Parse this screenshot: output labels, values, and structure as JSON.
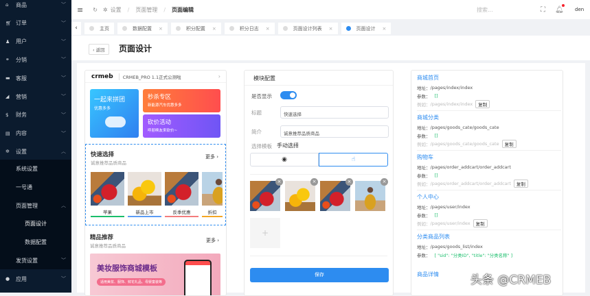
{
  "sidebar": {
    "items": [
      {
        "label": "商品",
        "icon": "basket-icon"
      },
      {
        "label": "订单",
        "icon": "cart-icon"
      },
      {
        "label": "用户",
        "icon": "user-icon"
      },
      {
        "label": "分销",
        "icon": "distribution-icon"
      },
      {
        "label": "客服",
        "icon": "chat-icon"
      },
      {
        "label": "营销",
        "icon": "megaphone-icon"
      },
      {
        "label": "财务",
        "icon": "dollar-icon"
      },
      {
        "label": "内容",
        "icon": "book-icon"
      },
      {
        "label": "设置",
        "icon": "gear-icon"
      }
    ],
    "sub": [
      "系统设置",
      "一号通",
      "页面管理",
      "发货设置"
    ],
    "sub2": [
      "页面设计",
      "数据配置"
    ],
    "last": "应用"
  },
  "header": {
    "breadcrumb": [
      "设置",
      "页面管理",
      "页面编辑"
    ],
    "search_placeholder": "搜索...",
    "user": "den"
  },
  "tabs": [
    {
      "label": "主页",
      "closable": false
    },
    {
      "label": "数据配置"
    },
    {
      "label": "积分配置"
    },
    {
      "label": "积分日志"
    },
    {
      "label": "页面设计列表"
    },
    {
      "label": "页面设计",
      "active": true
    }
  ],
  "page": {
    "back": "返回",
    "title": "页面设计"
  },
  "preview": {
    "logo": "crmeb",
    "app_title": "CRMEB_PRO 1.1正式公测啦",
    "banners": [
      {
        "title": "一起来拼团",
        "sub": "优惠多多"
      },
      {
        "title": "秒杀专区",
        "sub": "新能源汽车优惠多多"
      },
      {
        "title": "砍价活动",
        "sub": "呼朋唤友来砍价~"
      }
    ],
    "quick": {
      "title": "快速选择",
      "sub": "诚意推荐品质商品",
      "more": "更多",
      "items": [
        "苹果",
        "新品上市",
        "反季优惠",
        "折扣"
      ]
    },
    "featured": {
      "title": "精品推荐",
      "sub": "诚意推荐品质商品",
      "more": "更多",
      "banner_title": "美妆服饰商城模板",
      "banner_sub": "适用美妆、服饰、鲜花礼品、母婴童装等"
    }
  },
  "config": {
    "header": "模块配置",
    "show_label": "是否显示",
    "show": true,
    "title_label": "标题",
    "title_value": "快速选择",
    "intro_label": "简介",
    "intro_value": "诚意推荐品质商品",
    "template_label": "选择模板",
    "template_value": "手动选择",
    "save": "保存"
  },
  "links": [
    {
      "name": "商城首页",
      "addr_label": "地址：",
      "addr": "/pages/index/index",
      "param_label": "参数：",
      "param": "[]",
      "ex_label": "例如：",
      "ex": "/pages/index/index",
      "copy": "复制"
    },
    {
      "name": "商城分类",
      "addr_label": "地址：",
      "addr": "/pages/goods_cate/goods_cate",
      "param_label": "参数：",
      "param": "[]",
      "ex_label": "例如：",
      "ex": "/pages/goods_cate/goods_cate",
      "copy": "复制"
    },
    {
      "name": "购物车",
      "addr_label": "地址：",
      "addr": "/pages/order_addcart/order_addcart",
      "param_label": "参数：",
      "param": "[]",
      "ex_label": "例如：",
      "ex": "/pages/order_addcart/order_addcart",
      "copy": "复制"
    },
    {
      "name": "个人中心",
      "addr_label": "地址：",
      "addr": "/pages/user/index",
      "param_label": "参数：",
      "param": "[]",
      "ex_label": "例如：",
      "ex": "/pages/user/index",
      "copy": "复制"
    },
    {
      "name": "分类商品列表",
      "addr_label": "地址：",
      "addr": "/pages/goods_list/index",
      "param_label": "参数：",
      "param": "[ \"sid\": \"分类ID\", \"title\": \"分类名称\" ]"
    },
    {
      "name": "商品详情"
    }
  ],
  "watermark": "头条 @CRMEB"
}
